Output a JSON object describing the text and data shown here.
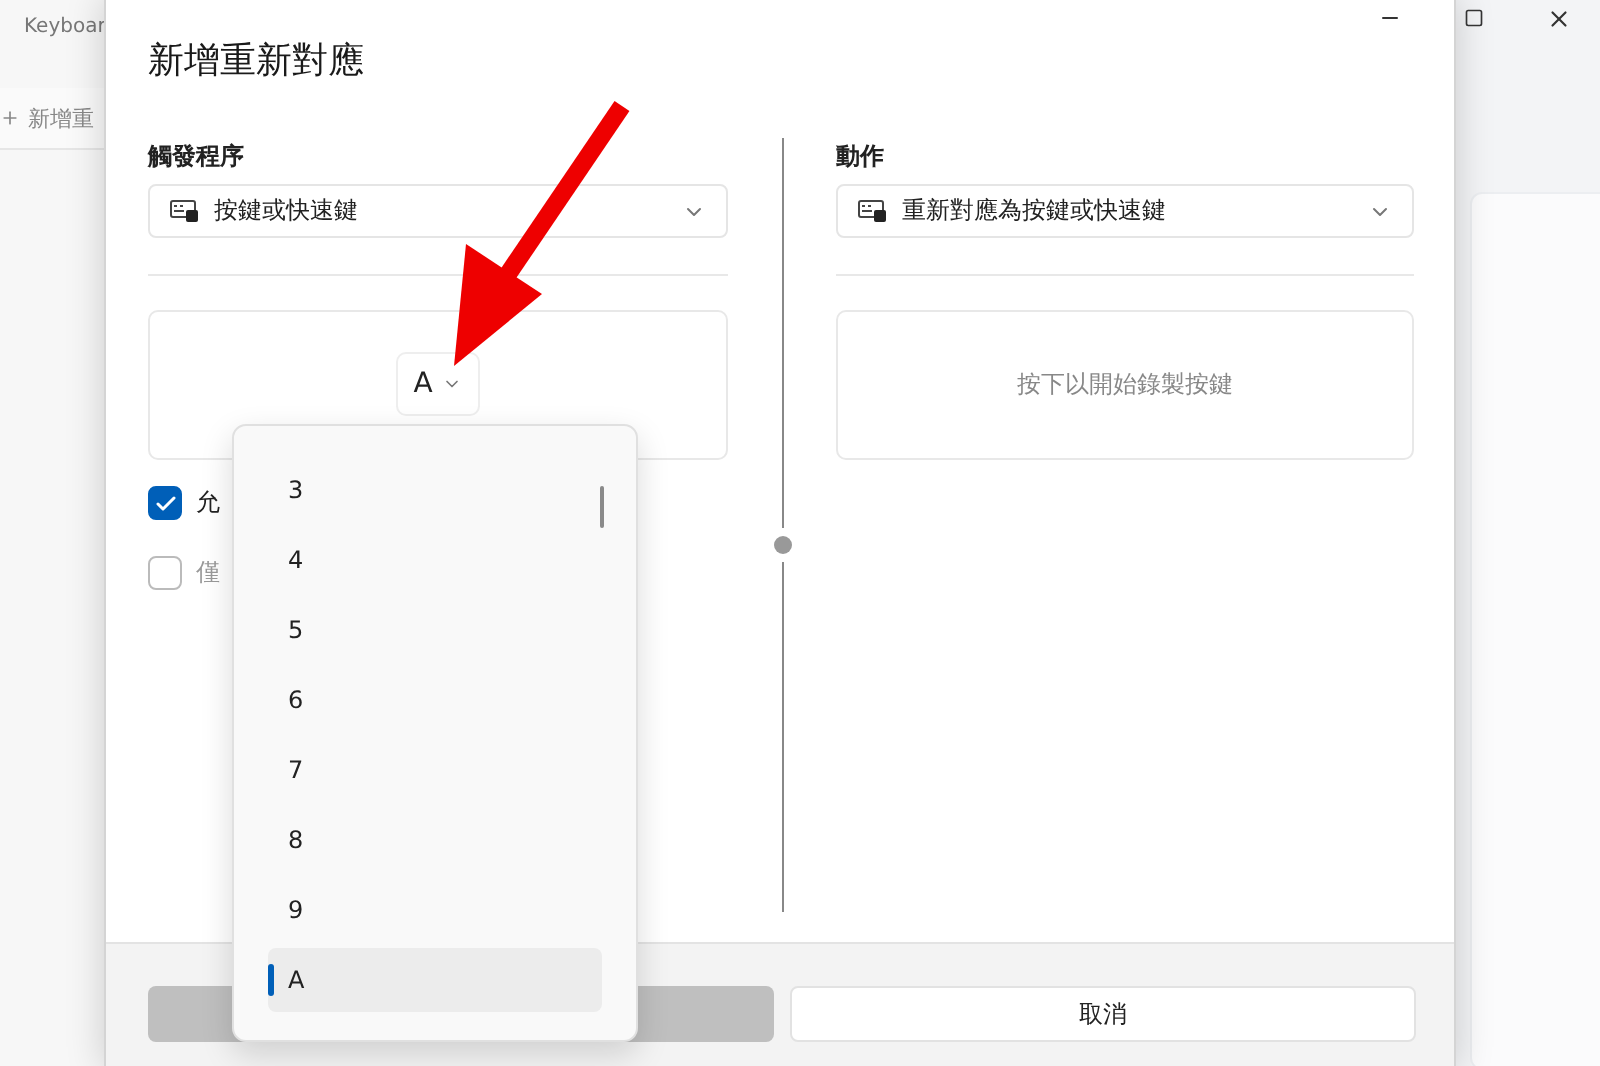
{
  "background_app": {
    "title": "Keyboar",
    "add_button": "新增重"
  },
  "dialog": {
    "title": "新增重新對應",
    "trigger": {
      "label": "觸發程序",
      "dropdown": "按鍵或快速鍵",
      "key": "A",
      "options": [
        {
          "label": "允",
          "checked": true,
          "disabled": false
        },
        {
          "label": "僅",
          "checked": false,
          "disabled": true
        }
      ]
    },
    "action": {
      "label": "動作",
      "dropdown": "重新對應為按鍵或快速鍵",
      "hint": "按下以開始錄製按鍵"
    },
    "buttons": [
      {
        "kind": "primary",
        "disabled": true
      },
      {
        "kind": "secondary",
        "label": "取消",
        "disabled": false
      }
    ]
  },
  "key_menu": {
    "items": [
      {
        "label": "3",
        "selected": false
      },
      {
        "label": "4",
        "selected": false
      },
      {
        "label": "5",
        "selected": false
      },
      {
        "label": "6",
        "selected": false
      },
      {
        "label": "7",
        "selected": false
      },
      {
        "label": "8",
        "selected": false
      },
      {
        "label": "9",
        "selected": false
      },
      {
        "label": "A",
        "selected": true
      }
    ]
  },
  "annotation": {
    "kind": "arrow"
  }
}
